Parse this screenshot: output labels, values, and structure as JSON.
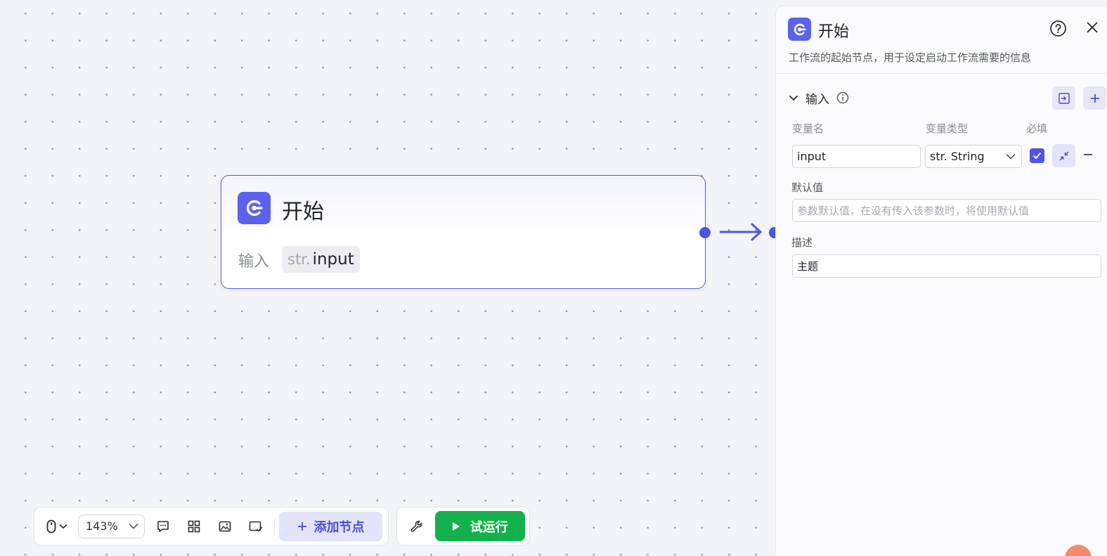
{
  "node": {
    "title": "开始",
    "input_label": "输入",
    "chip_type": "str.",
    "chip_name": "input"
  },
  "toolbar": {
    "zoom": "143%",
    "add_node_label": "添加节点",
    "run_label": "试运行"
  },
  "panel": {
    "title": "开始",
    "description": "工作流的起始节点，用于设定启动工作流需要的信息",
    "section_title": "输入",
    "columns": {
      "name": "变量名",
      "type": "变量类型",
      "required": "必填"
    },
    "variable": {
      "name": "input",
      "type": "str. String",
      "required": true
    },
    "default_label": "默认值",
    "default_placeholder": "参数默认值，在没有传入该参数时，将使用默认值",
    "desc_label": "描述",
    "desc_value": "主题"
  },
  "colors": {
    "accent": "#5b5ee6",
    "run_green": "#12b14c",
    "canvas_bg": "#f3f4f7"
  },
  "icons": [
    "mouse-icon",
    "chevron-down-icon",
    "comment-icon",
    "layout-grid-icon",
    "image-icon",
    "minimap-icon",
    "plus-icon",
    "wrench-icon",
    "play-icon",
    "help-icon",
    "close-icon",
    "import-icon",
    "info-icon",
    "checkmark-icon",
    "collapse-icon",
    "minus-icon",
    "start-node-icon"
  ]
}
